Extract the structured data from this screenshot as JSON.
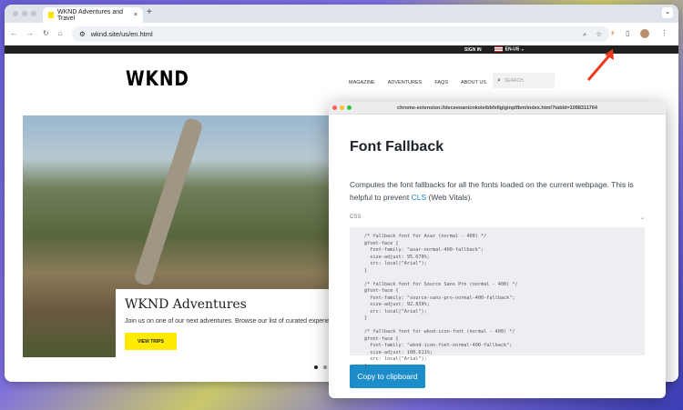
{
  "browser": {
    "tab_title": "WKND Adventures and Travel",
    "url": "wknd.site/us/en.html"
  },
  "site": {
    "sign_in": "SIGN IN",
    "locale": "EN-US",
    "logo": "WKND",
    "menu": [
      "MAGAZINE",
      "ADVENTURES",
      "FAQS",
      "ABOUT US"
    ],
    "search_placeholder": "SEARCH",
    "hero": {
      "title": "WKND Adventures",
      "text": "Join us on one of our next adventures. Browse our list of curated experiences",
      "button": "VIEW TRIPS"
    }
  },
  "popup": {
    "url": "chrome-extension://deceeoanicnkoieibbfellglginplfbm/index.html?tabId=1098311764",
    "title": "Font Fallback",
    "desc_before": "Computes the font fallbacks for all the fonts loaded on the current webpage. This is helpful to prevent ",
    "desc_link": "CLS",
    "desc_after": " (Web Vitals).",
    "section": "CSS",
    "code": "/* fallback font for Asar (normal - 400) */\n@font-face {\n  font-family: \"asar-normal-400-fallback\";\n  size-adjust: 95.679%;\n  src: local(\"Arial\");\n}\n\n/* fallback font for Source Sans Pro (normal - 400) */\n@font-face {\n  font-family: \"source-sans-pro-normal-400-fallback\";\n  size-adjust: 92.839%;\n  src: local(\"Arial\");\n}\n\n/* fallback font for wknd-icon-font (normal - 400) */\n@font-face {\n  font-family: \"wknd-icon-font-normal-400-fallback\";\n  size-adjust: 100.611%;\n  src: local(\"Arial\");\n}",
    "copy_button": "Copy to clipboard"
  },
  "colors": {
    "accent": "#1c8dc8",
    "brand_yellow": "#ffea00",
    "arrow": "#f03a1e"
  }
}
